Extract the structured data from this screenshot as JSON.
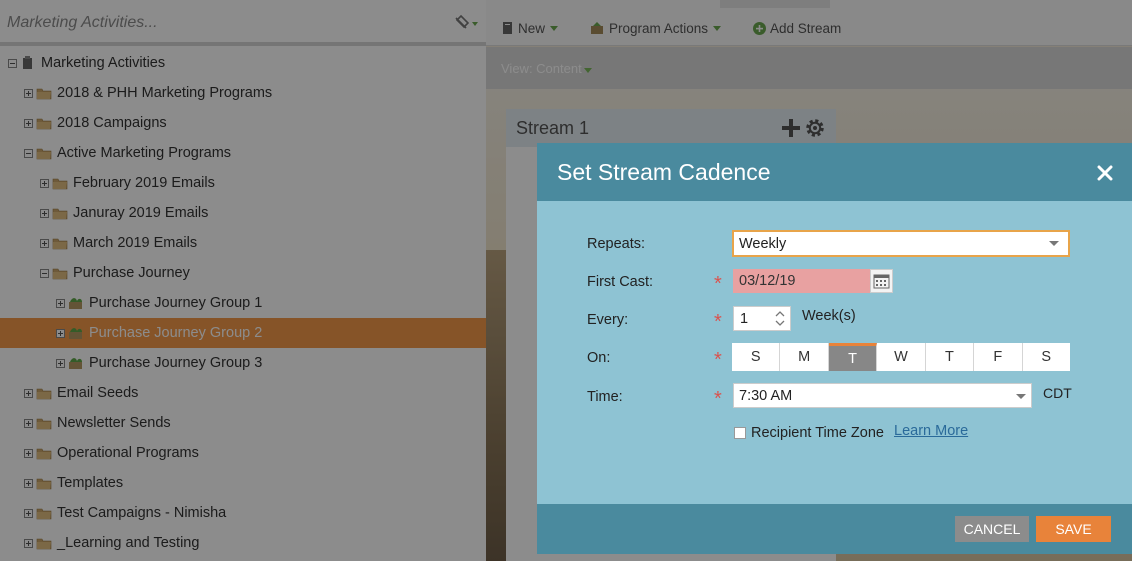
{
  "tree": {
    "search_placeholder": "Marketing Activities...",
    "items": [
      {
        "label": "Marketing Activities",
        "state": "minus",
        "type": "root"
      },
      {
        "label": "2018 & PHH Marketing Programs",
        "state": "plus",
        "type": "folder"
      },
      {
        "label": "2018 Campaigns",
        "state": "plus",
        "type": "folder"
      },
      {
        "label": "Active Marketing Programs",
        "state": "minus",
        "type": "folder"
      },
      {
        "label": "February 2019 Emails",
        "state": "plus",
        "type": "folder"
      },
      {
        "label": "Januray 2019 Emails",
        "state": "plus",
        "type": "folder"
      },
      {
        "label": "March 2019 Emails",
        "state": "plus",
        "type": "folder"
      },
      {
        "label": "Purchase Journey",
        "state": "minus",
        "type": "folder"
      },
      {
        "label": "Purchase Journey Group 1",
        "state": "plus",
        "type": "program"
      },
      {
        "label": "Purchase Journey Group 2",
        "state": "plus",
        "type": "program",
        "selected": true
      },
      {
        "label": "Purchase Journey Group 3",
        "state": "plus",
        "type": "program"
      },
      {
        "label": "Email Seeds",
        "state": "plus",
        "type": "folder"
      },
      {
        "label": "Newsletter Sends",
        "state": "plus",
        "type": "folder"
      },
      {
        "label": "Operational Programs",
        "state": "plus",
        "type": "folder"
      },
      {
        "label": "Templates",
        "state": "plus",
        "type": "folder"
      },
      {
        "label": "Test Campaigns - Nimisha",
        "state": "plus",
        "type": "folder"
      },
      {
        "label": "_Learning and Testing",
        "state": "plus",
        "type": "folder"
      }
    ]
  },
  "toolbar": {
    "new_label": "New",
    "program_actions_label": "Program Actions",
    "add_stream_label": "Add Stream"
  },
  "view": {
    "label": "View: Content"
  },
  "stream": {
    "title": "Stream 1"
  },
  "dialog": {
    "title": "Set Stream Cadence",
    "repeats_label": "Repeats:",
    "repeats_value": "Weekly",
    "first_cast_label": "First Cast:",
    "first_cast_value": "03/12/19",
    "every_label": "Every:",
    "every_value": "1",
    "every_unit": "Week(s)",
    "on_label": "On:",
    "days": [
      {
        "label": "S",
        "active": false
      },
      {
        "label": "M",
        "active": false
      },
      {
        "label": "T",
        "active": true
      },
      {
        "label": "W",
        "active": false
      },
      {
        "label": "T",
        "active": false
      },
      {
        "label": "F",
        "active": false
      },
      {
        "label": "S",
        "active": false
      }
    ],
    "time_label": "Time:",
    "time_value": "7:30 AM",
    "timezone": "CDT",
    "recipient_tz_label": "Recipient Time Zone",
    "learn_more_label": "Learn More",
    "required_mark": "*",
    "cancel_label": "CANCEL",
    "save_label": "SAVE"
  },
  "colors": {
    "dialog_header": "#4a8a9e",
    "dialog_body": "#8ec3d3",
    "selected_row": "#f59a4a",
    "save": "#e8833a",
    "cancel": "#8c8c8c",
    "invalid_field": "#e8a1a1"
  }
}
